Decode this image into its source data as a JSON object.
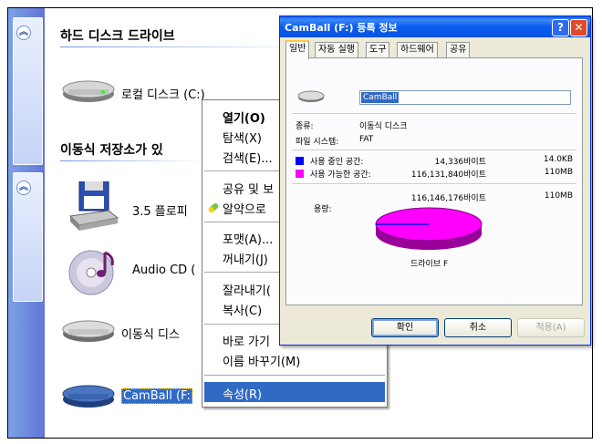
{
  "window": {
    "sections": [
      {
        "title": "하드 디스크 드라이브"
      },
      {
        "title": "이동식 저장소가 있"
      }
    ],
    "drives": [
      {
        "label": "로컬 디스크 (C:)",
        "icon": "hard-disk-icon"
      },
      {
        "label": "3.5 플로피",
        "icon": "floppy-drive-icon"
      },
      {
        "label": "Audio CD (",
        "icon": "cd-drive-icon"
      },
      {
        "label": "이동식 디스",
        "icon": "removable-disk-icon"
      },
      {
        "label": "CamBall (F:",
        "icon": "camball-drive-icon",
        "selected": true
      }
    ]
  },
  "context_menu": {
    "items": [
      {
        "label": "열기(O)",
        "bold": true
      },
      {
        "label": "탐색(X)"
      },
      {
        "label": "검색(E)..."
      },
      {
        "label": "공유 및 보"
      },
      {
        "label": "알약으로"
      },
      {
        "label": "포맷(A)..."
      },
      {
        "label": "꺼내기(J)"
      },
      {
        "label": "잘라내기("
      },
      {
        "label": "복사(C)"
      },
      {
        "label": "바로 가기"
      },
      {
        "label": "이름 바꾸기(M)"
      },
      {
        "label": "속성(R)",
        "highlighted": true
      }
    ]
  },
  "dialog": {
    "title": "CamBall (F:) 등록 정보",
    "tabs": [
      "일반",
      "자동 실행",
      "도구",
      "하드웨어",
      "공유"
    ],
    "active_tab": "일반",
    "name": "CamBall",
    "type_label": "종류:",
    "type_value": "이동식 디스크",
    "fs_label": "파일 시스템:",
    "fs_value": "FAT",
    "used_label": "사용 중인 공간:",
    "used_bytes": "14,336바이트",
    "used_size": "14.0KB",
    "free_label": "사용 가능한 공간:",
    "free_bytes": "116,131,840바이트",
    "free_size": "110MB",
    "capacity_label": "용량:",
    "capacity_bytes": "116,146,176바이트",
    "capacity_size": "110MB",
    "drive_caption": "드라이브 F",
    "colors": {
      "used": "#0000ff",
      "free": "#ff00ff"
    },
    "buttons": {
      "ok": "확인",
      "cancel": "취소",
      "apply": "적용(A)"
    }
  }
}
